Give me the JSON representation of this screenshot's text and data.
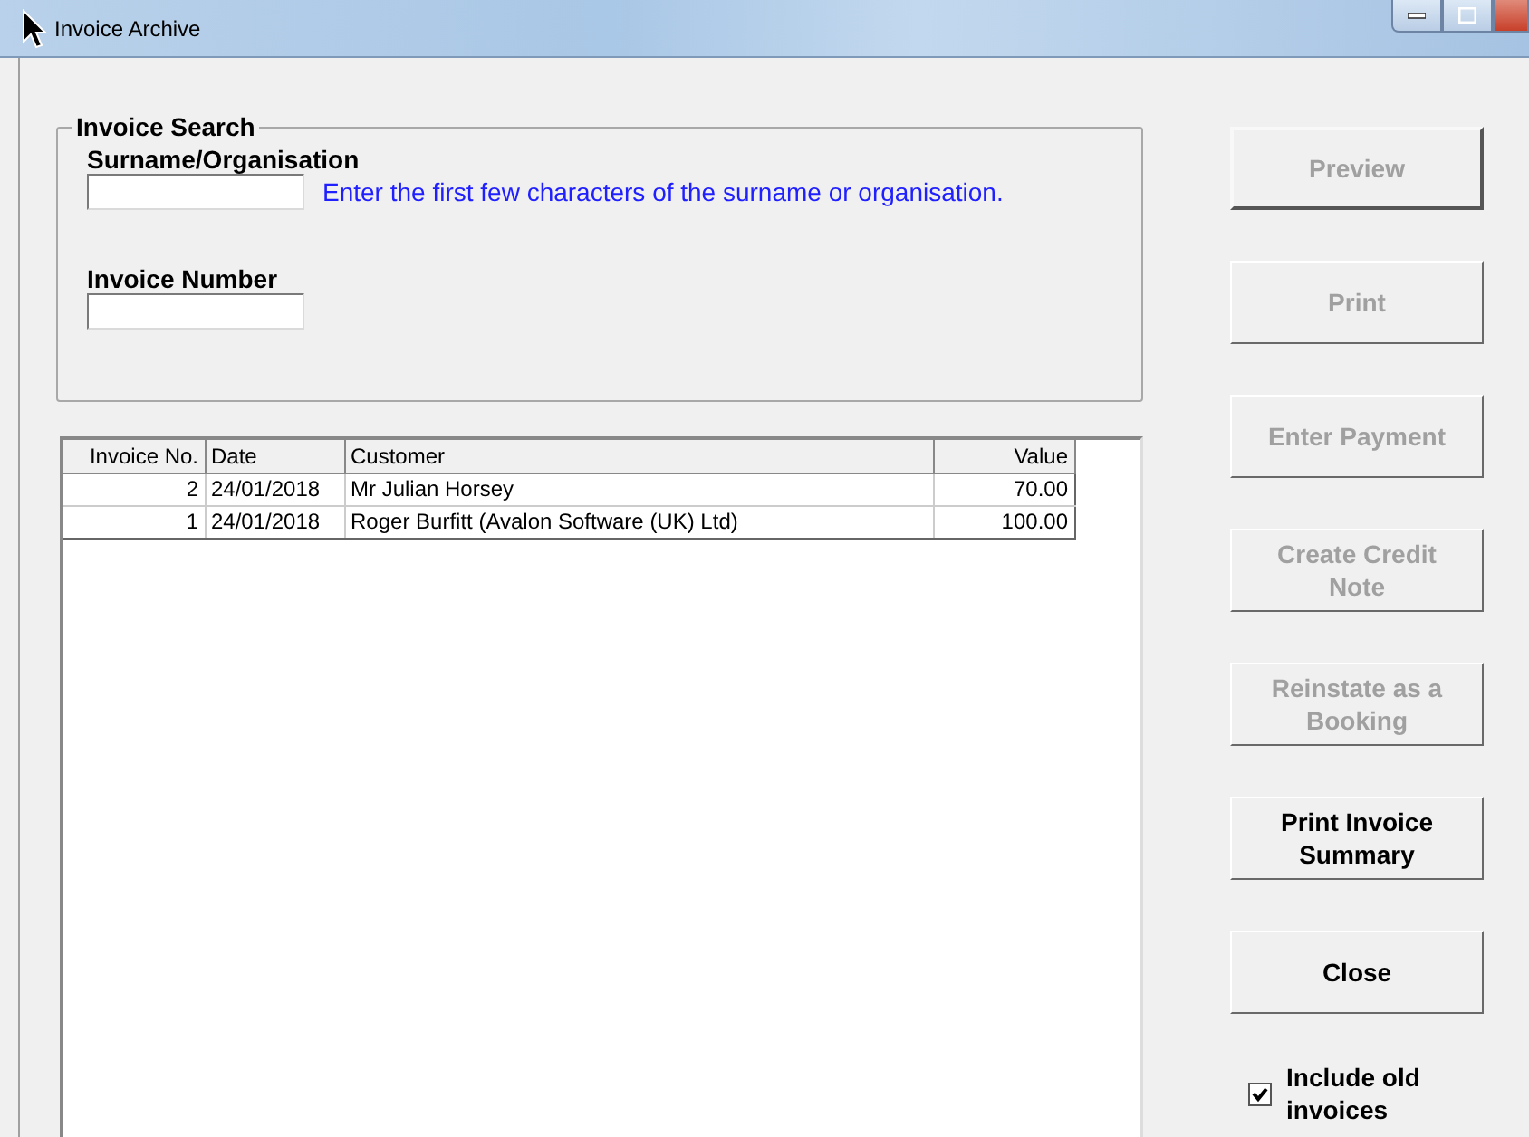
{
  "window": {
    "title": "Invoice Archive"
  },
  "search": {
    "title": "Invoice Search",
    "fields": [
      {
        "label": "Surname/Organisation",
        "hint": "Enter the first few characters of the surname or organisation."
      },
      {
        "label": "Invoice Number"
      }
    ]
  },
  "table": {
    "columns": [
      {
        "label": "Invoice No.",
        "numeric": true
      },
      {
        "label": "Date",
        "numeric": false
      },
      {
        "label": "Customer",
        "numeric": false
      },
      {
        "label": "Value",
        "numeric": true
      }
    ],
    "rows": [
      [
        "2",
        "24/01/2018",
        "Mr Julian Horsey",
        "70.00"
      ],
      [
        "1",
        "24/01/2018",
        "Roger Burfitt (Avalon Software (UK) Ltd)",
        "100.00"
      ]
    ]
  },
  "buttons": [
    {
      "label": "Preview",
      "disabled": true,
      "default": true
    },
    {
      "label": "Print",
      "disabled": true,
      "default": false
    },
    {
      "label": "Enter Payment",
      "disabled": true,
      "default": false
    },
    {
      "label": "Create Credit Note",
      "disabled": true,
      "default": false
    },
    {
      "label": "Reinstate as a Booking",
      "disabled": true,
      "default": false
    },
    {
      "label": "Print Invoice Summary",
      "disabled": false,
      "default": false
    },
    {
      "label": "Close",
      "disabled": false,
      "default": false
    }
  ],
  "include_old": {
    "label": "Include old invoices",
    "checked": true
  }
}
